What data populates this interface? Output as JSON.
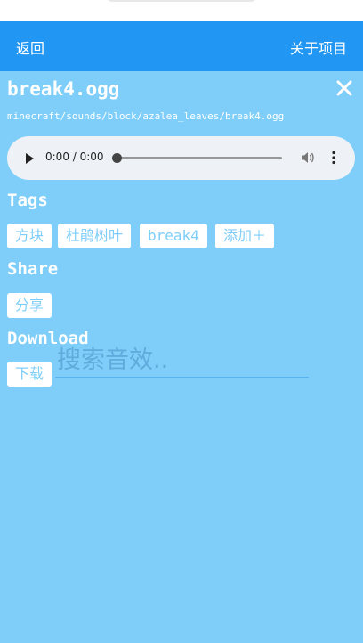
{
  "nav": {
    "back_label": "返回",
    "about_label": "关于项目"
  },
  "file": {
    "title": "break4.ogg",
    "path": "minecraft/sounds/block/azalea_leaves/break4.ogg"
  },
  "player": {
    "time": "0:00 / 0:00",
    "progress": 0
  },
  "tags": {
    "heading": "Tags",
    "items": [
      "方块",
      "杜鹃树叶",
      "break4",
      "添加＋"
    ]
  },
  "share": {
    "heading": "Share",
    "button_label": "分享"
  },
  "download": {
    "heading": "Download",
    "button_label": "下载"
  },
  "search": {
    "placeholder": "搜索音效.."
  },
  "colors": {
    "appbar": "#2196f3",
    "background": "#7ecef9",
    "chip_text": "#7ecef9"
  },
  "icons": {
    "close": "close-icon",
    "play": "play-icon",
    "volume": "volume-icon",
    "more": "more-vertical-icon"
  }
}
